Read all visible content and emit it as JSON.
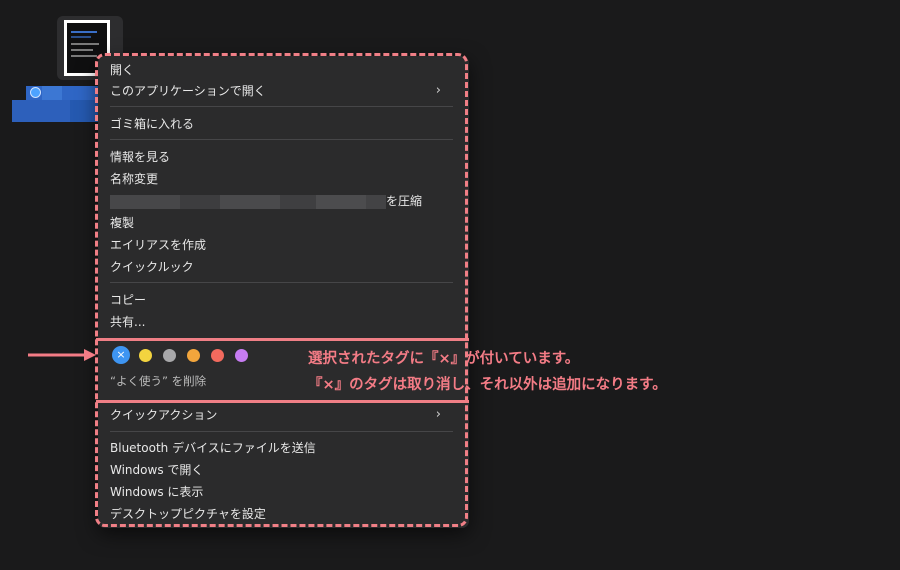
{
  "menu": {
    "open": "開く",
    "open_with": "このアプリケーションで開く",
    "move_to_trash": "ゴミ箱に入れる",
    "get_info": "情報を見る",
    "rename": "名称変更",
    "compress_suffix": "を圧縮",
    "duplicate": "複製",
    "make_alias": "エイリアスを作成",
    "quick_look": "クイックルック",
    "copy": "コピー",
    "share": "共有...",
    "remove_favorites": "“よく使う” を削除",
    "quick_actions": "クイックアクション",
    "bluetooth_send": "Bluetooth デバイスにファイルを送信",
    "windows_open": "Windows で開く",
    "windows_show": "Windows に表示",
    "set_desktop_picture": "デスクトップピクチャを設定"
  },
  "tags": {
    "selected_mark": "×",
    "colors": [
      "#3e95f2",
      "#f3d43f",
      "#a8a8aa",
      "#f2a53c",
      "#f26a5e",
      "#c77cf2"
    ]
  },
  "annotation": {
    "line1": "選択されたタグに『×』が付いています。",
    "line2": "『×』のタグは取り消し、それ以外は追加になります。"
  },
  "colors": {
    "accent_annotation": "#f47c86",
    "menu_bg": "#2b2b2c"
  }
}
